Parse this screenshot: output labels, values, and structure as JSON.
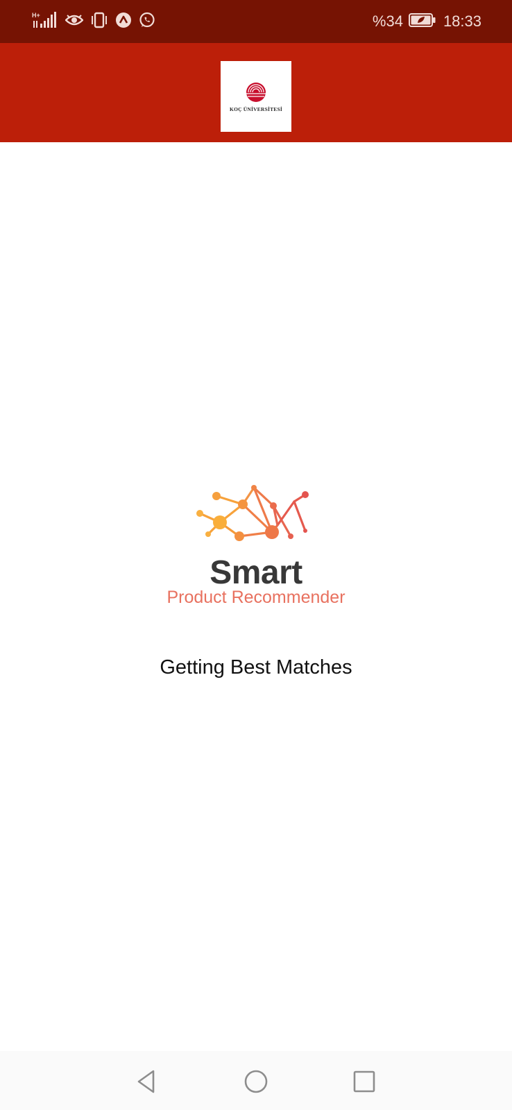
{
  "status_bar": {
    "network_label": "H+",
    "battery_percent": "%34",
    "time": "18:33",
    "icons": [
      "signal-icon",
      "eye-comfort-icon",
      "vibrate-icon",
      "app-notification-icon",
      "whatsapp-icon",
      "battery-icon"
    ]
  },
  "app_bar": {
    "logo_text": "KOÇ ÜNİVERSİTESİ",
    "background_color": "#bc1f09"
  },
  "brand_logo": {
    "title": "Smart",
    "subtitle": "Product Recommender",
    "accent_color": "#e8715f"
  },
  "loading": {
    "message": "Getting Best Matches"
  },
  "nav_bar": {
    "buttons": [
      "back-icon",
      "home-icon",
      "recents-icon"
    ]
  }
}
